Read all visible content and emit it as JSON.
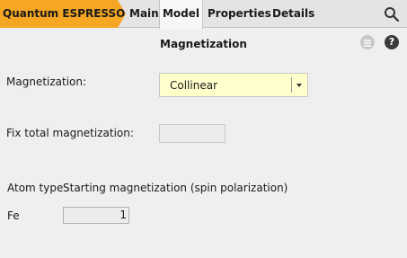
{
  "app": {
    "brand": "Quantum ESPRESSO",
    "tabs": [
      "Main",
      "Model",
      "Properties",
      "Details"
    ],
    "active_tab": "Model"
  },
  "colors": {
    "brand": "#f5a623",
    "active_tab_bg": "#f7f7f7",
    "select_bg": "#ffffcc"
  },
  "icons": {
    "search": "search-icon",
    "menu": "menu-icon",
    "help": "help-icon"
  },
  "panel": {
    "title": "Magnetization",
    "help_glyph": "?"
  },
  "magnetization": {
    "label": "Magnetization:",
    "value": "Collinear"
  },
  "fix_total": {
    "label": "Fix total magnetization:",
    "value": ""
  },
  "atoms": {
    "col_type": "Atom type",
    "col_start": "Starting magnetization (spin polarization)",
    "rows": [
      {
        "type": "Fe",
        "value": "1"
      }
    ]
  }
}
